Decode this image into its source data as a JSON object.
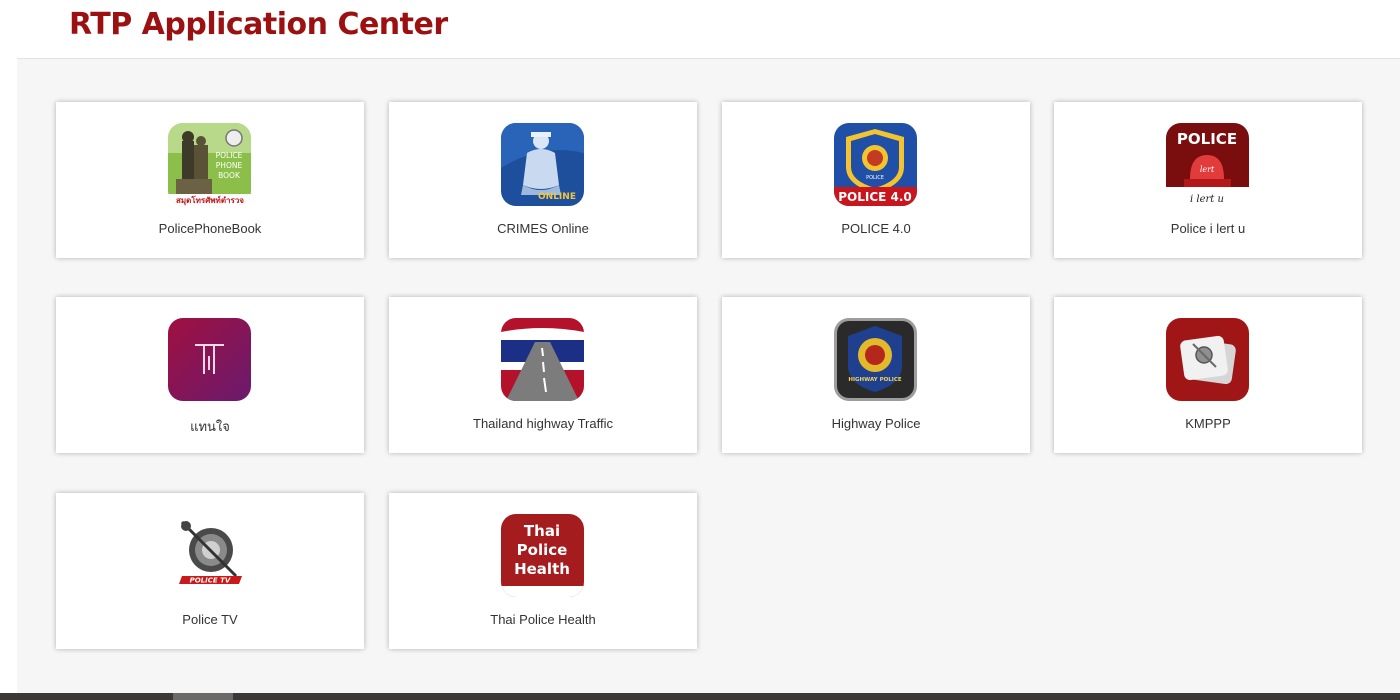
{
  "header": {
    "title": "RTP Application Center"
  },
  "apps": [
    {
      "label": "PolicePhoneBook",
      "icon": "police-phone-book-icon",
      "icon_text": [
        "POLICE",
        "PHONE",
        "BOOK",
        "สมุดโทรศัพท์ตำรวจ"
      ]
    },
    {
      "label": "CRIMES Online",
      "icon": "crimes-online-icon",
      "icon_text": [
        "ONLINE"
      ]
    },
    {
      "label": "POLICE 4.0",
      "icon": "police-4-icon",
      "icon_text": [
        "POLICE 4.0",
        "POLICE"
      ]
    },
    {
      "label": "Police i lert u",
      "icon": "police-i-lert-u-icon",
      "icon_text": [
        "POLICE",
        "lert",
        "i lert u"
      ]
    },
    {
      "label": "แทนใจ",
      "icon": "tanjai-icon",
      "icon_text": []
    },
    {
      "label": "Thailand highway Traffic",
      "icon": "highway-traffic-icon",
      "icon_text": []
    },
    {
      "label": "Highway Police",
      "icon": "highway-police-icon",
      "icon_text": [
        "HIGHWAY POLICE"
      ]
    },
    {
      "label": "KMPPP",
      "icon": "kmppp-icon",
      "icon_text": []
    },
    {
      "label": "Police TV",
      "icon": "police-tv-icon",
      "icon_text": [
        "POLICE TV"
      ]
    },
    {
      "label": "Thai Police Health",
      "icon": "thai-police-health-icon",
      "icon_text": [
        "Thai",
        "Police",
        "Health"
      ]
    }
  ],
  "colors": {
    "title": "#9b1010",
    "page_bg": "#f6f6f6",
    "card_bg": "#ffffff"
  }
}
